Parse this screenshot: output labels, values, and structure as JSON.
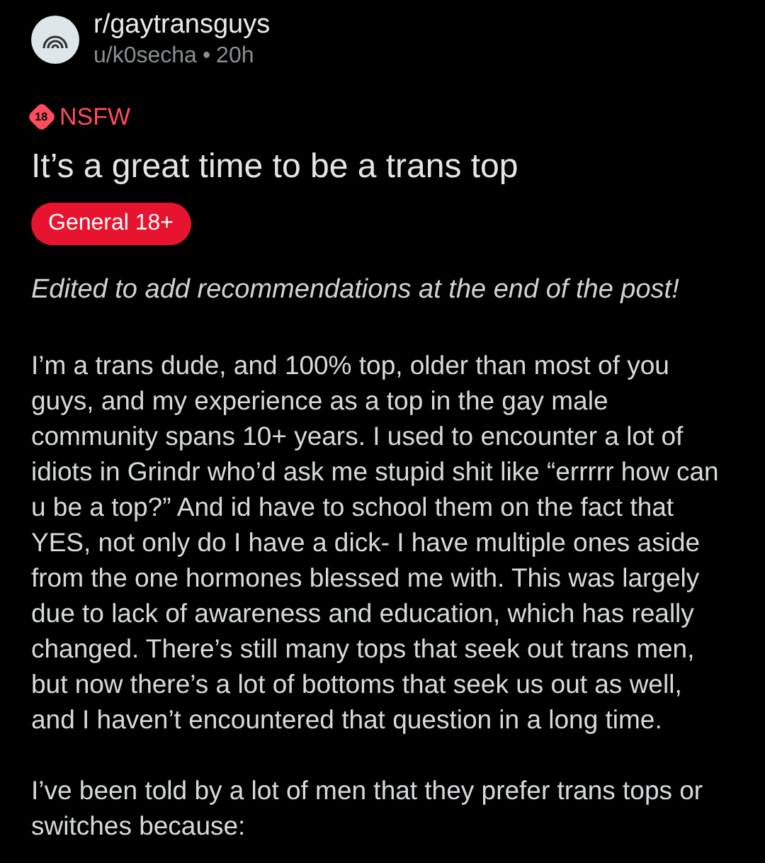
{
  "post": {
    "subreddit": "r/gaytransguys",
    "author": "u/k0secha",
    "separator": "•",
    "age": "20h",
    "nsfw_icon_text": "18",
    "nsfw_label": "NSFW",
    "title": "It’s a great time to be a trans top",
    "flair": "General 18+",
    "edit_note": "Edited to add recommendations at the end of the post!",
    "paragraphs": [
      "I’m a trans dude, and 100% top, older than most of you guys, and my experience as a top in the gay male community spans 10+ years. I used to encounter a lot of idiots in Grindr who’d ask me stupid shit like “errrrr how can u be a top?” And id have to school them on the fact that YES, not only do I have a dick- I have multiple ones aside from the one hormones blessed me with. This was largely due to lack of awareness and education, which has really changed. There’s still many tops that seek out trans men, but now there’s a lot of bottoms that seek us out as well, and I haven’t encountered that question in a long time.",
      "I’ve been told by a lot of men that they prefer trans tops or switches because:"
    ]
  }
}
